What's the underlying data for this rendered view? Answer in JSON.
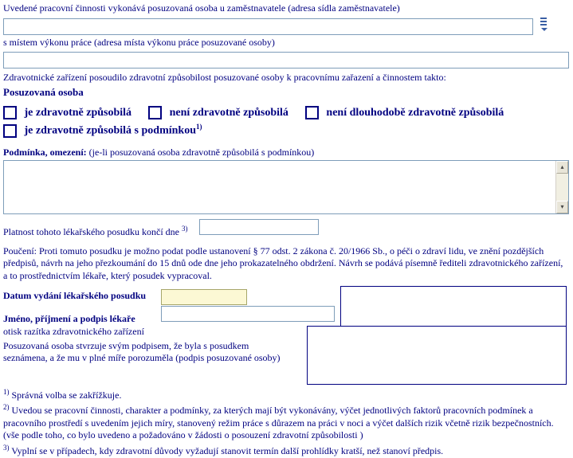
{
  "labels": {
    "line1": "Uvedené pracovní činnosti vykonává posuzovaná osoba u zaměstnavatele (adresa sídla zaměstnavatele)",
    "line2": "s místem výkonu práce (adresa místa výkonu práce posuzované osoby)",
    "line3": "Zdravotnické zařízení posoudilo zdravotní způsobilost posuzované osoby k pracovnímu zařazení a činnostem takto:",
    "heading": "Posuzovaná osoba",
    "opt1": "je zdravotně způsobilá",
    "opt2": "není zdravotně způsobilá",
    "opt3": "není dlouhodobě zdravotně způsobilá",
    "opt4": "je zdravotně způsobilá s podmínkou",
    "opt4sup": "1)",
    "condition_label": "Podmínka, omezení:",
    "condition_note": " (je-li posuzovaná osoba zdravotně způsobilá s podmínkou)",
    "valid_until": "Platnost tohoto lékařského posudku končí dne ",
    "valid_until_sup": "3)",
    "pouceni": "Poučení: Proti tomuto posudku je možno podat podle ustanovení § 77 odst. 2 zákona č. 20/1966 Sb., o péči o zdraví lidu, ve znění pozdějších předpisů, návrh na jeho přezkoumání do 15 dnů ode dne jeho prokazatelného obdržení. Návrh se podává písemně řediteli zdravotnického zařízení, a to prostřednictvím lékaře, který posudek vypracoval.",
    "date_label": "Datum vydání lékařského posudku",
    "name_label": "Jméno, příjmení a podpis lékaře",
    "stamp_label": "otisk razítka zdravotnického zařízení",
    "confirm1": "Posuzovaná osoba stvrzuje svým podpisem, že byla s posudkem",
    "confirm2": "seznámena, a že mu v plné míře porozuměla (podpis posuzované osoby)",
    "note1_sup": "1)",
    "note1": "  Správná  volba se zakřížkuje.",
    "note2_sup": "2)",
    "note2": "  Uvedou se pracovní činnosti, charakter a podmínky, za kterých mají být vykonávány,  výčet jednotlivých faktorů pracovních podmínek a pracovního prostředí  s uvedením jejich míry, stanovený režim práce s důrazem na práci v noci a výčet dalších rizik včetně rizik bezpečnostních.  (vše podle toho, co bylo uvedeno a požadováno v žádosti o posouzení zdravotní způsobilosti )",
    "note3_sup": "3)",
    "note3": "  Vyplní se v případech, kdy zdravotní důvody vyžadují stanovit termín další prohlídky kratší, než stanoví předpis."
  }
}
